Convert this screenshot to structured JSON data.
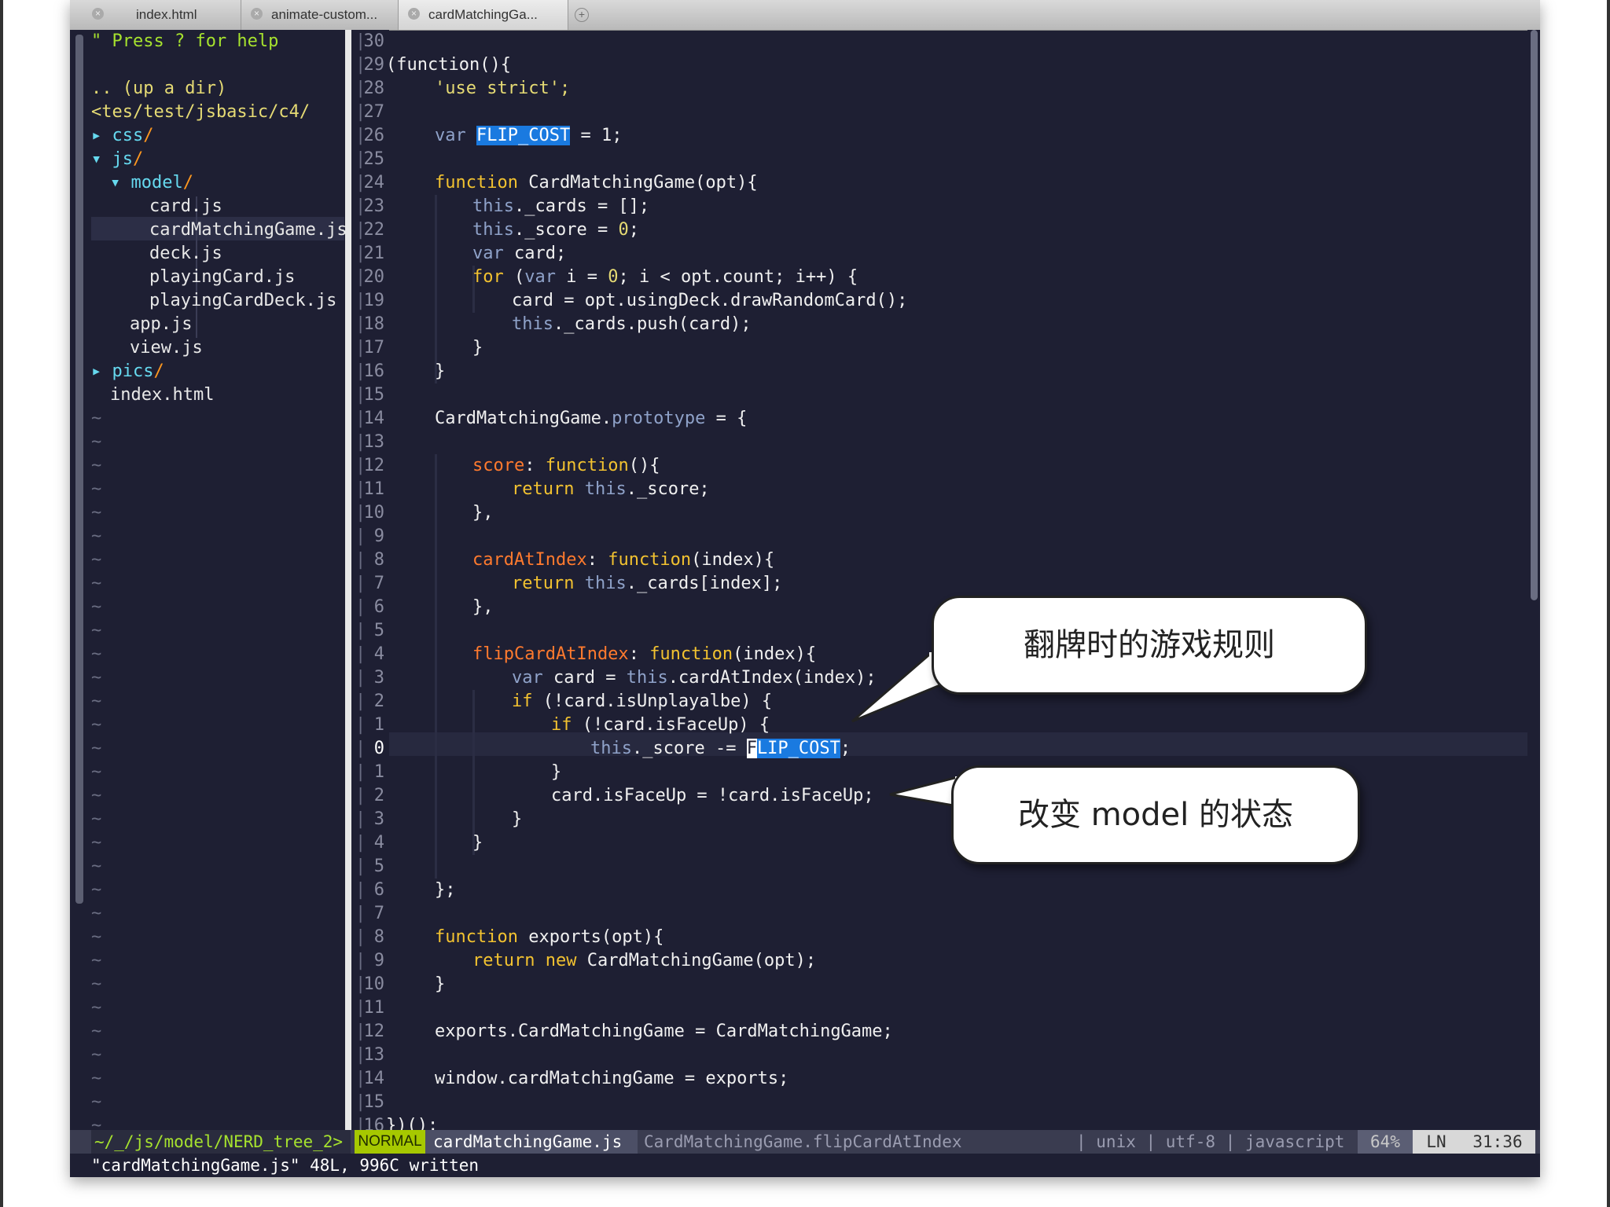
{
  "tabs": [
    {
      "label": "index.html"
    },
    {
      "label": "animate-custom..."
    },
    {
      "label": "cardMatchingGa..."
    }
  ],
  "tab_add_icon": "+",
  "sidebar": {
    "help": "\" Press ? for help",
    "up": ".. (up a dir)",
    "path": "<tes/test/jsbasic/c4/",
    "items": [
      {
        "arrow": "▸",
        "name": "css",
        "slash": "/"
      },
      {
        "arrow": "▾",
        "name": "js",
        "slash": "/"
      },
      {
        "arrow": "▾",
        "name": "model",
        "slash": "/"
      },
      {
        "name": "card.js"
      },
      {
        "name": "cardMatchingGame.js"
      },
      {
        "name": "deck.js"
      },
      {
        "name": "playingCard.js"
      },
      {
        "name": "playingCardDeck.js"
      },
      {
        "name": "app.js"
      },
      {
        "name": "view.js"
      },
      {
        "arrow": "▸",
        "name": "pics",
        "slash": "/"
      },
      {
        "name": "index.html"
      }
    ],
    "tilde": "~"
  },
  "gutter": [
    "30",
    "29",
    "28",
    "27",
    "26",
    "25",
    "24",
    "23",
    "22",
    "21",
    "20",
    "19",
    "18",
    "17",
    "16",
    "15",
    "14",
    "13",
    "12",
    "11",
    "10",
    "9",
    "8",
    "7",
    "6",
    "5",
    "4",
    "3",
    "2",
    "1",
    "0",
    "1",
    "2",
    "3",
    "4",
    "5",
    "6",
    "7",
    "8",
    "9",
    "10",
    "11",
    "12",
    "13",
    "14",
    "15",
    "16"
  ],
  "gutter_bar": "|",
  "code": {
    "l1": "(function(){",
    "l2": "'use strict';",
    "l4_var": "var",
    "l4_name": "FLIP_COST",
    "l4_rest": " = 1;",
    "l6_kw": "function",
    "l6_rest": " CardMatchingGame(opt){",
    "l7_this": "this",
    "l7_rest": "._cards = [];",
    "l8_this": "this",
    "l8_rest": "._score = ",
    "l8_num": "0",
    "l8_end": ";",
    "l9_var": "var",
    "l9_rest": " card;",
    "l10_for": "for",
    "l10_a": " (",
    "l10_var": "var",
    "l10_b": " i = ",
    "l10_num": "0",
    "l10_c": "; i < opt.count; i++) {",
    "l11": "card = opt.usingDeck.drawRandomCard();",
    "l12_this": "this",
    "l12_rest": "._cards.push(card);",
    "l13": "}",
    "l14": "}",
    "l16_a": "CardMatchingGame.",
    "l16_proto": "prototype",
    "l16_b": " = {",
    "l18_prop": "score",
    "l18_a": ": ",
    "l18_kw": "function",
    "l18_b": "(){",
    "l19_ret": "return",
    "l19_this": " this",
    "l19_rest": "._score;",
    "l20": "},",
    "l22_prop": "cardAtIndex",
    "l22_a": ": ",
    "l22_kw": "function",
    "l22_b": "(index){",
    "l23_ret": "return",
    "l23_this": " this",
    "l23_rest": "._cards[index];",
    "l24": "},",
    "l26_prop": "flipCardAtIndex",
    "l26_a": ": ",
    "l26_kw": "function",
    "l26_b": "(index){",
    "l27_var": "var",
    "l27_a": " card = ",
    "l27_this": "this",
    "l27_b": ".cardAtIndex(index);",
    "l28_if": "if",
    "l28_rest": " (!card.isUnplayalbe) {",
    "l29_if": "if",
    "l29_rest": " (!card.isFaceUp) {",
    "l30_this": "this",
    "l30_a": "._score -= ",
    "l30_cursor": "F",
    "l30_hl": "LIP_COST",
    "l30_end": ";",
    "l31": "}",
    "l32": "card.isFaceUp = !card.isFaceUp;",
    "l33": "}",
    "l34": "}",
    "l36": "};",
    "l38_kw": "function",
    "l38_rest": " exports(opt){",
    "l39_ret": "return",
    "l39_new": " new",
    "l39_rest": " CardMatchingGame(opt);",
    "l40": "}",
    "l42": "exports.CardMatchingGame = CardMatchingGame;",
    "l44": "window.cardMatchingGame = exports;",
    "l46": "})();"
  },
  "status": {
    "tree": "~/_/js/model/NERD_tree_2>",
    "mode": "NORMAL",
    "file": "cardMatchingGame.js",
    "func": "CardMatchingGame.flipCardAtIndex",
    "enc": "| unix | utf-8 | javascript",
    "pct": "64%",
    "ln": "LN",
    "pos": "31:36"
  },
  "cmdline": "\"cardMatchingGame.js\" 48L, 996C written",
  "bubbles": {
    "b1": "翻牌时的游戏规则",
    "b2": "改变 model 的状态"
  }
}
